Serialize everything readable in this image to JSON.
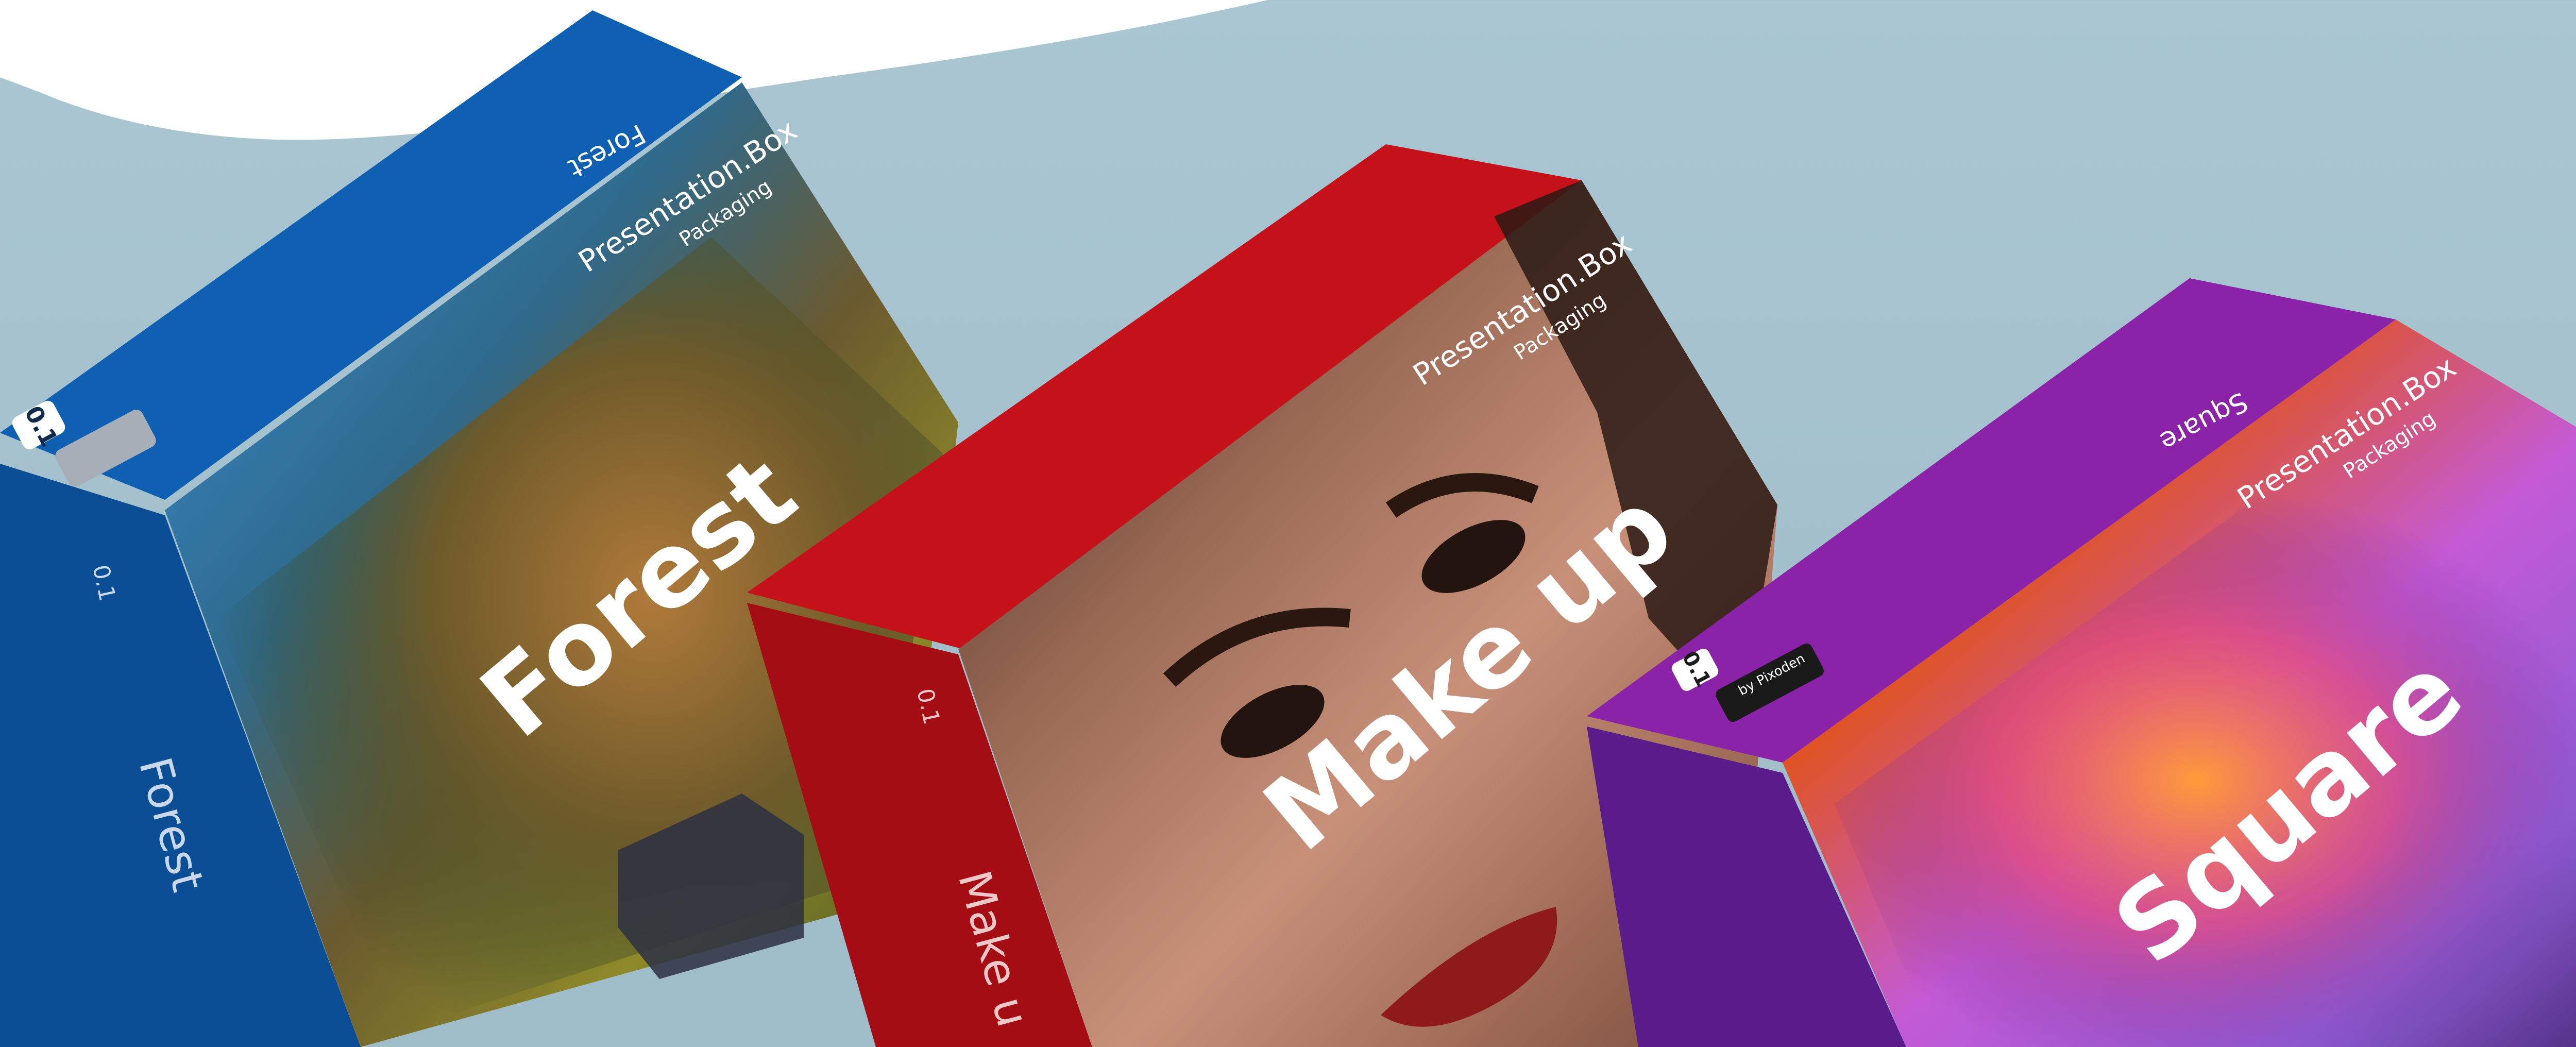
{
  "scene": {
    "background_color": "#a5c2ce",
    "boxes": [
      {
        "id": "forest",
        "title": "Forest",
        "brand": "Presentation.Box",
        "subtitle": "Packaging",
        "top_label": "Forest",
        "side_title": "Forest",
        "side_number": "0.1",
        "badge": "0.1",
        "color": "#0f57a8"
      },
      {
        "id": "makeup",
        "title": "Make up",
        "brand": "Presentation.Box",
        "subtitle": "Packaging",
        "side_title": "Make u",
        "side_number": "0.1",
        "color": "#b40f16"
      },
      {
        "id": "square",
        "title": "Square",
        "brand": "Presentation.Box",
        "subtitle": "Packaging",
        "top_label": "Square",
        "badge": "0.1",
        "badge_text": "by Pixoden",
        "color": "#7a1c9c"
      }
    ]
  }
}
